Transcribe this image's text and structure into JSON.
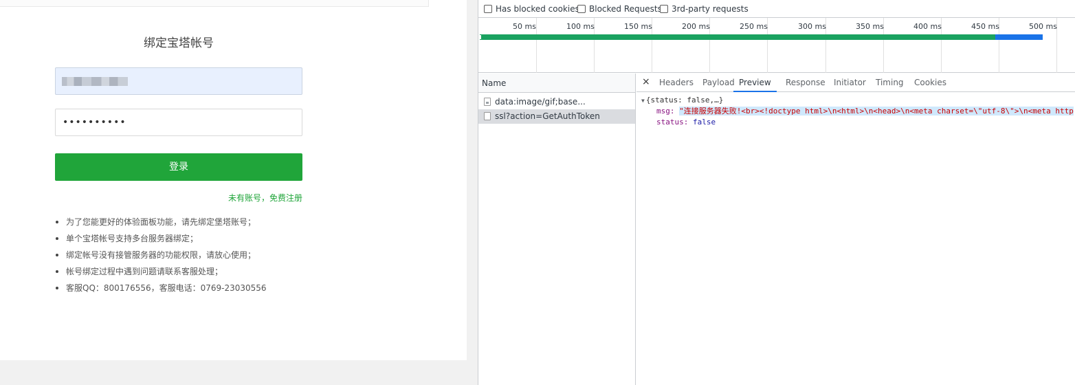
{
  "login": {
    "title": "绑定宝塔帐号",
    "password_value": "••••••••••",
    "login_button": "登录",
    "register_link": "未有账号，免费注册",
    "notes": [
      "为了您能更好的体验面板功能，请先绑定堡塔账号；",
      "单个宝塔帐号支持多台服务器绑定；",
      "绑定帐号没有接管服务器的功能权限，请放心使用；",
      "帐号绑定过程中遇到问题请联系客服处理；",
      "客服QQ：800176556，客服电话：0769-23030556"
    ]
  },
  "devtools": {
    "filters": [
      "Has blocked cookies",
      "Blocked Requests",
      "3rd-party requests"
    ],
    "ticks": [
      "50 ms",
      "100 ms",
      "150 ms",
      "200 ms",
      "250 ms",
      "300 ms",
      "350 ms",
      "400 ms",
      "450 ms",
      "500 ms"
    ],
    "name_header": "Name",
    "requests": [
      "data:image/gif;base...",
      "ssl?action=GetAuthToken"
    ],
    "tabs": [
      "Headers",
      "Payload",
      "Preview",
      "Response",
      "Initiator",
      "Timing",
      "Cookies"
    ],
    "active_tab": "Preview",
    "preview": {
      "summary": "{status: false,…}",
      "msg_key": "msg",
      "msg_value": "\"连接服务器失败!<br><!doctype html>\\n<html>\\n<head>\\n<meta charset=\\\"utf-8\\\">\\n<meta http",
      "status_key": "status",
      "status_value": "false"
    }
  },
  "colors": {
    "accent_green": "#20a53a",
    "devtools_blue": "#1a73e8",
    "timeline_green": "#1aa260"
  }
}
